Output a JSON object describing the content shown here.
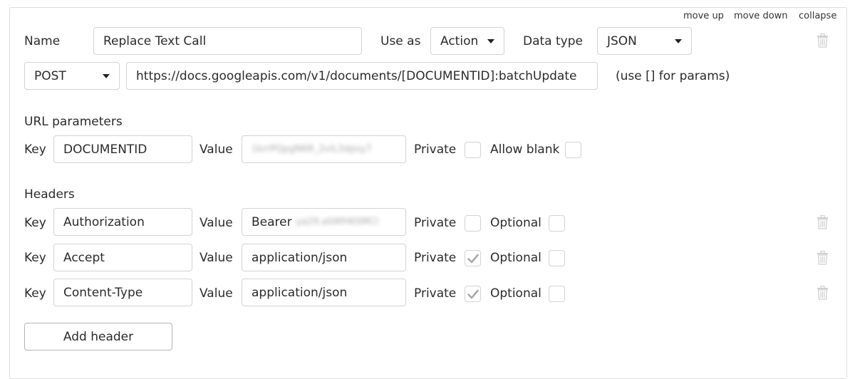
{
  "top_links": {
    "move_up": "move up",
    "move_down": "move down",
    "collapse": "collapse"
  },
  "call": {
    "name_label": "Name",
    "name_value": "Replace Text Call",
    "use_as_label": "Use as",
    "use_as_value": "Action",
    "data_type_label": "Data type",
    "data_type_value": "JSON",
    "method_value": "POST",
    "url_value": "https://docs.googleapis.com/v1/documents/[DOCUMENTID]:batchUpdate",
    "url_hint": "(use [] for params)"
  },
  "url_params": {
    "title": "URL parameters",
    "key_label": "Key",
    "key_value": "DOCUMENTID",
    "value_label": "Value",
    "value_redacted": "1krrPQpgN6R_2vlL3dpsy7",
    "private_label": "Private",
    "private_checked": false,
    "allow_blank_label": "Allow blank",
    "allow_blank_checked": false
  },
  "headers": {
    "title": "Headers",
    "key_label": "Key",
    "value_label": "Value",
    "private_label": "Private",
    "optional_label": "Optional",
    "rows": [
      {
        "key": "Authorization",
        "value_prefix": "Bearer ",
        "value_redacted": "ya29.a0AfH6SMCI",
        "private": false,
        "optional": false
      },
      {
        "key": "Accept",
        "value": "application/json",
        "private": true,
        "optional": false
      },
      {
        "key": "Content-Type",
        "value": "application/json",
        "private": true,
        "optional": false
      }
    ],
    "add_button": "Add header"
  },
  "colors": {
    "border": "#d3d3d3",
    "text": "#2b2b2b",
    "check": "#a9a9a9",
    "trash": "#cfcfcf"
  }
}
